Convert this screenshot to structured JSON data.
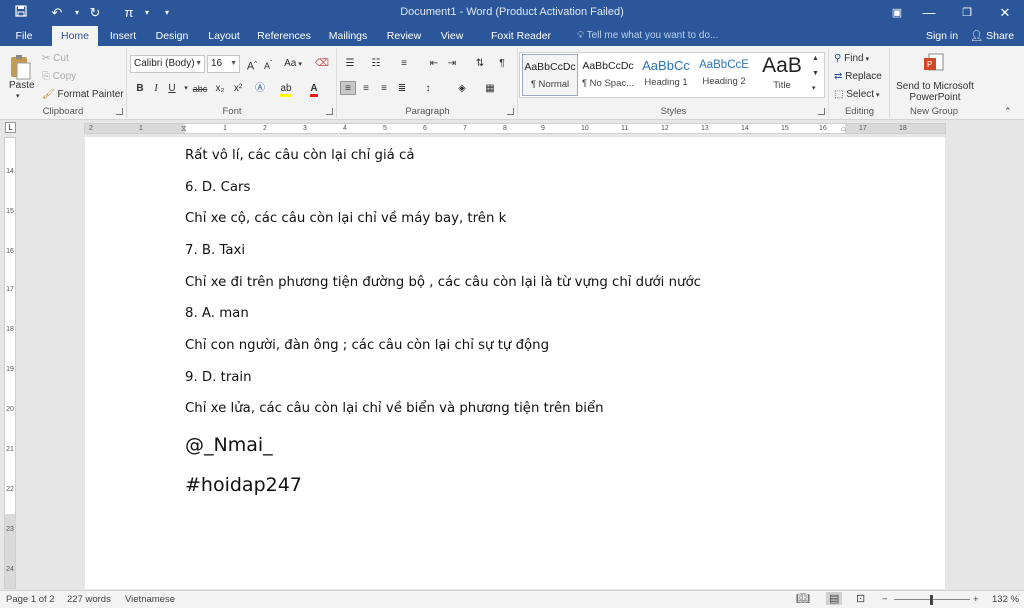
{
  "titlebar": {
    "title": "Document1 - Word (Product Activation Failed)",
    "save_icon": "save-icon",
    "undo_icon": "undo-icon",
    "redo_icon": "redo-icon",
    "equation_icon": "π"
  },
  "tabs": [
    "File",
    "Home",
    "Insert",
    "Design",
    "Layout",
    "References",
    "Mailings",
    "Review",
    "View",
    "Foxit Reader PDF"
  ],
  "active_tab": "Home",
  "tell_me": "Tell me what you want to do...",
  "sign_in": "Sign in",
  "share": "Share",
  "clipboard": {
    "paste": "Paste",
    "cut": "Cut",
    "copy": "Copy",
    "format_painter": "Format Painter",
    "label": "Clipboard"
  },
  "font": {
    "family": "Calibri (Body)",
    "size": "16",
    "grow": "A",
    "shrink": "A",
    "case": "Aa",
    "bold": "B",
    "italic": "I",
    "underline": "U",
    "strike": "abc",
    "sub": "x₂",
    "sup": "x²",
    "label": "Font"
  },
  "paragraph": {
    "label": "Paragraph"
  },
  "styles": {
    "items": [
      {
        "preview": "AaBbCcDc",
        "name": "¶ Normal"
      },
      {
        "preview": "AaBbCcDc",
        "name": "¶ No Spac..."
      },
      {
        "preview": "AaBbCc",
        "name": "Heading 1"
      },
      {
        "preview": "AaBbCcE",
        "name": "Heading 2"
      },
      {
        "preview": "AaB",
        "name": "Title"
      }
    ],
    "label": "Styles"
  },
  "editing": {
    "find": "Find",
    "replace": "Replace",
    "select": "Select",
    "label": "Editing"
  },
  "new_group": {
    "send_line1": "Send to Microsoft",
    "send_line2": "PowerPoint",
    "label": "New Group"
  },
  "ruler": {
    "h_ticks": [
      "2",
      "1",
      "1",
      "2",
      "3",
      "4",
      "5",
      "6",
      "7",
      "8",
      "9",
      "10",
      "11",
      "12",
      "13",
      "14",
      "15",
      "16",
      "17",
      "18"
    ],
    "v_ticks": [
      "14",
      "15",
      "16",
      "17",
      "18",
      "19",
      "20",
      "21",
      "22",
      "23",
      "24"
    ]
  },
  "document": {
    "lines": [
      "Rất vô lí, các câu còn lại chỉ giá cả",
      "6. D. Cars",
      "Chỉ xe cộ, các câu còn lại chỉ về máy bay, trên k",
      "7. B. Taxi",
      "Chỉ xe đi trên phương tiện đường bộ , các câu còn lại là từ vựng chỉ dưới nước",
      "8. A. man",
      "Chỉ con người, đàn ông ; các câu còn lại chỉ sự tự động",
      "9. D. train",
      "Chỉ xe lửa, các câu còn lại chỉ về biển và phương tiện trên biển"
    ],
    "sig1": "@_Nmai_",
    "sig2": "#hoidap247"
  },
  "status": {
    "page": "Page 1 of 2",
    "words": "227 words",
    "language": "Vietnamese",
    "zoom": "132 %"
  }
}
